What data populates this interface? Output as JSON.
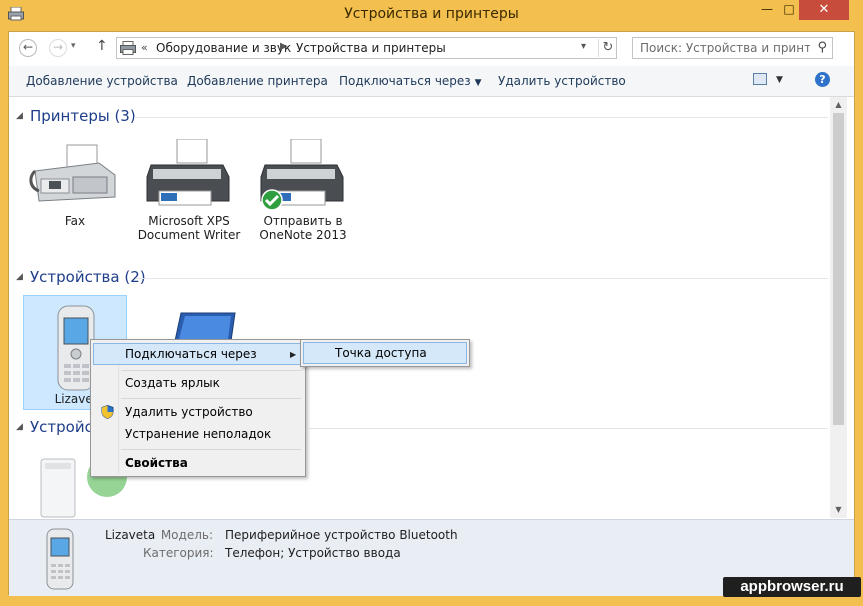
{
  "window": {
    "title": "Устройства и принтеры"
  },
  "nav": {
    "breadcrumb_prefix": "«",
    "crumbs": [
      "Оборудование и звук",
      "Устройства и принтеры"
    ],
    "search_placeholder": "Поиск: Устройства и принте..."
  },
  "commands": {
    "add_device": "Добавление устройства",
    "add_printer": "Добавление принтера",
    "connect_via": "Подключаться через",
    "remove_device": "Удалить устройство"
  },
  "groups": {
    "printers": "Принтеры (3)",
    "devices": "Устройства (2)",
    "third": "Устройст"
  },
  "printers": [
    {
      "label": "Fax"
    },
    {
      "label": "Microsoft XPS Document Writer"
    },
    {
      "label": "Отправить в OneNote 2013"
    }
  ],
  "devices": [
    {
      "label": "Lizavet"
    }
  ],
  "context_menu": {
    "items": [
      "Подключаться через",
      "Создать ярлык",
      "Удалить устройство",
      "Устранение неполадок",
      "Свойства"
    ]
  },
  "submenu": {
    "items": [
      "Точка доступа"
    ]
  },
  "details": {
    "name": "Lizaveta",
    "model_key": "Модель:",
    "model_val": "Периферийное устройство Bluetooth",
    "category_key": "Категория:",
    "category_val": "Телефон; Устройство ввода"
  },
  "watermark": "appbrowser.ru",
  "colors": {
    "frame": "#f3bf4e",
    "close": "#c74c3c",
    "group_title": "#1e3e8a",
    "selection": "#cde8ff"
  }
}
